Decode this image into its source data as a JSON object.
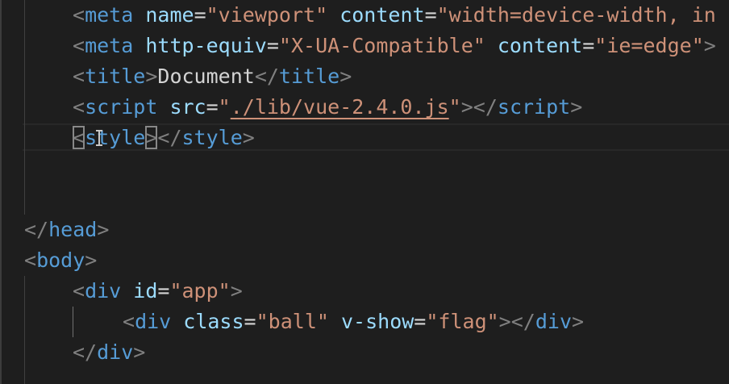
{
  "lines": {
    "meta_viewport": {
      "open": "<",
      "tag": "meta",
      "attr1": "name",
      "eq1": "=",
      "val1": "\"viewport\"",
      "attr2": "content",
      "eq2": "=",
      "val2": "\"width=device-width, in"
    },
    "meta_compat": {
      "open": "<",
      "tag": "meta",
      "attr1": "http-equiv",
      "eq1": "=",
      "val1": "\"X-UA-Compatible\"",
      "attr2": "content",
      "eq2": "=",
      "val2": "\"ie=edge\"",
      "close": ">"
    },
    "title": {
      "open": "<",
      "tag": "title",
      "close": ">",
      "text": "Document",
      "end_open": "</",
      "end_tag": "title",
      "end_close": ">"
    },
    "script": {
      "open": "<",
      "tag": "script",
      "attr": "src",
      "eq": "=",
      "quote_open": "\"",
      "val": "./lib/vue-2.4.0.js",
      "quote_close": "\"",
      "close": ">",
      "end_open": "</",
      "end_tag": "script",
      "end_close": ">"
    },
    "style": {
      "open": "<",
      "tag": "style",
      "close": ">",
      "end_open": "</",
      "end_tag": "style",
      "end_close": ">"
    },
    "head_close": {
      "open": "</",
      "tag": "head",
      "close": ">"
    },
    "body_open": {
      "open": "<",
      "tag": "body",
      "close": ">"
    },
    "div_app": {
      "open": "<",
      "tag": "div",
      "attr": "id",
      "eq": "=",
      "val": "\"app\"",
      "close": ">"
    },
    "div_ball": {
      "open": "<",
      "tag": "div",
      "attr1": "class",
      "eq1": "=",
      "val1": "\"ball\"",
      "attr2": "v-show",
      "eq2": "=",
      "val2": "\"flag\"",
      "close": ">",
      "end_open": "</",
      "end_tag": "div",
      "end_close": ">"
    },
    "div_close": {
      "open": "</",
      "tag": "div",
      "close": ">"
    }
  },
  "colors": {
    "background": "#1e1e1e",
    "tag_punct": "#808080",
    "tag_name": "#569cd6",
    "attr_name": "#9cdcfe",
    "attr_value": "#ce9178",
    "text": "#d4d4d4"
  },
  "icons": {
    "cursor": "text-cursor-ibeam-icon"
  }
}
